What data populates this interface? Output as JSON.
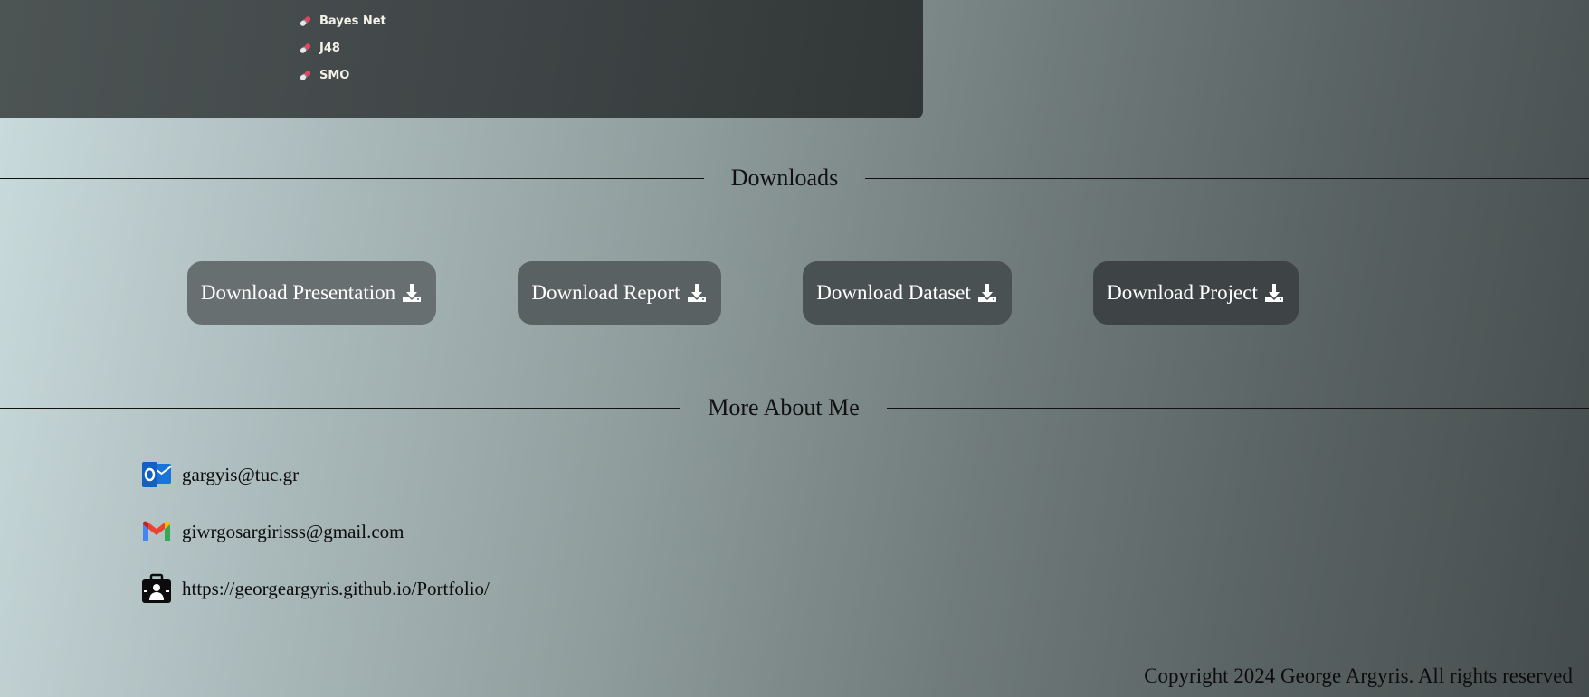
{
  "algorithms": {
    "items": [
      {
        "label": "Bayes Net",
        "icon": "pill-icon"
      },
      {
        "label": "J48",
        "icon": "pill-icon"
      },
      {
        "label": "SMO",
        "icon": "pill-icon"
      }
    ]
  },
  "downloads": {
    "title": "Downloads",
    "buttons": [
      {
        "label": "Download Presentation",
        "icon": "download-icon"
      },
      {
        "label": "Download Report",
        "icon": "download-icon"
      },
      {
        "label": "Download Dataset",
        "icon": "download-icon"
      },
      {
        "label": "Download Project",
        "icon": "download-icon"
      }
    ]
  },
  "about": {
    "title": "More About Me",
    "contacts": [
      {
        "text": "gargyis@tuc.gr",
        "icon": "outlook-icon"
      },
      {
        "text": "giwrgosargirisss@gmail.com",
        "icon": "gmail-icon"
      },
      {
        "text": "https://georgeargyris.github.io/Portfolio/",
        "icon": "portfolio-icon"
      }
    ]
  },
  "footer": {
    "copyright": "Copyright 2024 George Argyris. All rights reserved"
  },
  "colors": {
    "button_bg_1": "#686f70",
    "button_bg_2": "#5a6162",
    "button_bg_3": "#4a5152",
    "button_bg_4": "#3e4445",
    "outlook_blue": "#1a73d9",
    "gmail_red": "#ea4335"
  }
}
